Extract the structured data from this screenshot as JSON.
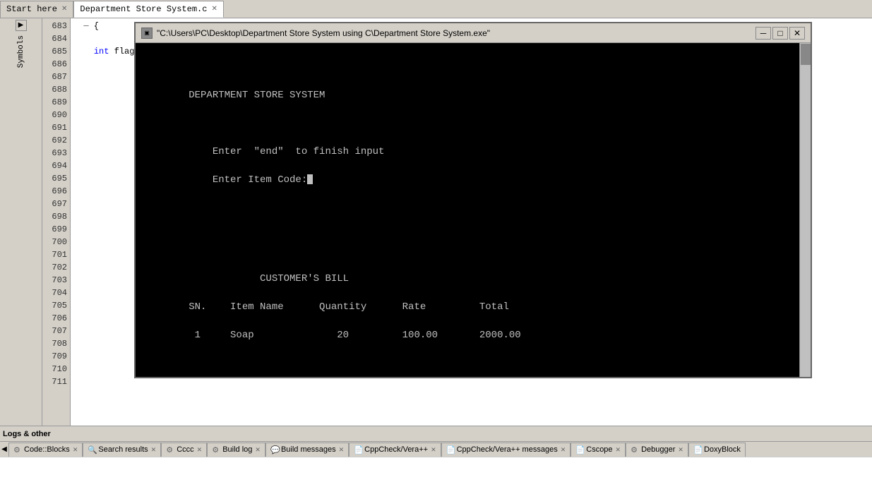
{
  "tabs": {
    "items": [
      {
        "label": "Start here",
        "active": false,
        "closable": true
      },
      {
        "label": "Department Store System.c",
        "active": true,
        "closable": true
      }
    ]
  },
  "symbols_panel": {
    "title": "Symbols",
    "arrow_label": "▶"
  },
  "line_numbers": [
    683,
    684,
    685,
    686,
    687,
    688,
    689,
    690,
    691,
    692,
    693,
    694,
    695,
    696,
    697,
    698,
    699,
    700,
    701,
    702,
    703,
    704,
    705,
    706,
    707,
    708,
    709,
    710,
    711
  ],
  "code_lines": [
    "{",
    "",
    "    int flag",
    "",
    "",
    "",
    "",
    "",
    "",
    "",
    "",
    "",
    "",
    "",
    "",
    "",
    "",
    "",
    "",
    "",
    "",
    "",
    "",
    "",
    "",
    "",
    "",
    "",
    ""
  ],
  "terminal": {
    "title": "\"C:\\Users\\PC\\Desktop\\Department Store System using C\\Department Store System.exe\"",
    "icon": "▣",
    "lines": [
      "",
      "",
      "",
      "        DEPARTMENT STORE SYSTEM",
      "",
      "",
      "",
      "            Enter  \"end\"  to finish input",
      "",
      "            Enter Item Code:_",
      "",
      "",
      "",
      "",
      "",
      "",
      "                    CUSTOMER'S BILL",
      "",
      "        SN.    Item Name      Quantity      Rate         Total",
      "",
      "         1     Soap              20         100.00       2000.00"
    ],
    "controls": {
      "minimize": "─",
      "maximize": "□",
      "close": "✕"
    }
  },
  "log_header": {
    "title": "Logs & other"
  },
  "bottom_tabs": [
    {
      "label": "Code::Blocks",
      "icon": "gear",
      "active": false,
      "closable": true
    },
    {
      "label": "Search results",
      "icon": "search",
      "active": false,
      "closable": true
    },
    {
      "label": "Cccc",
      "icon": "gear",
      "active": false,
      "closable": true
    },
    {
      "label": "Build log",
      "icon": "gear",
      "active": false,
      "closable": true
    },
    {
      "label": "Build messages",
      "icon": "msg",
      "active": false,
      "closable": true
    },
    {
      "label": "CppCheck/Vera++",
      "icon": "file",
      "active": false,
      "closable": true
    },
    {
      "label": "CppCheck/Vera++ messages",
      "icon": "file",
      "active": false,
      "closable": true
    },
    {
      "label": "Cscope",
      "icon": "file",
      "active": false,
      "closable": true
    },
    {
      "label": "Debugger",
      "icon": "gear",
      "active": false,
      "closable": true
    },
    {
      "label": "DoxyBlock",
      "icon": "file",
      "active": false,
      "closable": false
    }
  ]
}
